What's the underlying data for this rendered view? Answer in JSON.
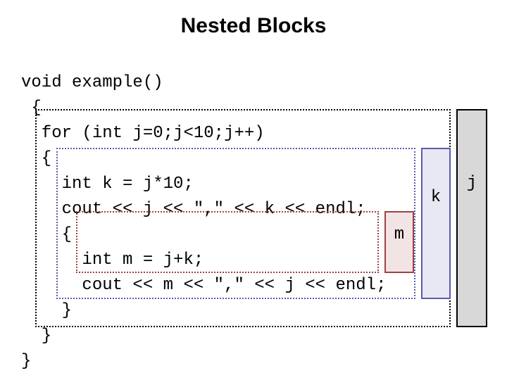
{
  "title": "Nested Blocks",
  "code": {
    "l1": "void example()",
    "l2": " {",
    "l3": "  for (int j=0;j<10;j++)",
    "l4": "  {",
    "l5": "    int k = j*10;",
    "l6": "    cout << j << \",\" << k << endl;",
    "l7": "    {",
    "l8": "      int m = j+k;",
    "l9": "      cout << m << \",\" << j << endl;",
    "l10": "    }",
    "l11": "  }",
    "l12": "}"
  },
  "vars": {
    "j": "j",
    "k": "k",
    "m": "m"
  }
}
